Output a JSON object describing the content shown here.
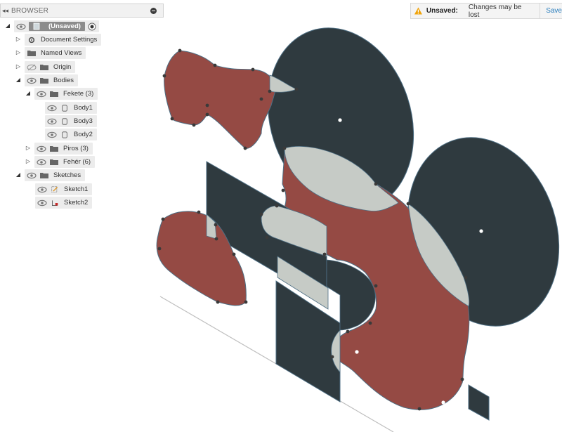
{
  "browser": {
    "title": "BROWSER",
    "root_label": "(Unsaved)",
    "items": [
      {
        "label": "Document Settings"
      },
      {
        "label": "Named Views"
      },
      {
        "label": "Origin"
      },
      {
        "label": "Bodies"
      },
      {
        "label": "Fekete (3)"
      },
      {
        "label": "Body1"
      },
      {
        "label": "Body3"
      },
      {
        "label": "Body2"
      },
      {
        "label": "Piros (3)"
      },
      {
        "label": "Fehér (6)"
      },
      {
        "label": "Sketches"
      },
      {
        "label": "Sketch1"
      },
      {
        "label": "Sketch2"
      }
    ]
  },
  "notice": {
    "status": "Unsaved:",
    "message": "Changes may be lost",
    "save_label": "Save"
  },
  "colors": {
    "dark_body": "#2f3a3f",
    "red_body": "#954a44",
    "light_body": "#c6cbc6",
    "edge": "#4e6f84",
    "accent_link": "#2c7fbe",
    "warning": "#f0a30a"
  }
}
